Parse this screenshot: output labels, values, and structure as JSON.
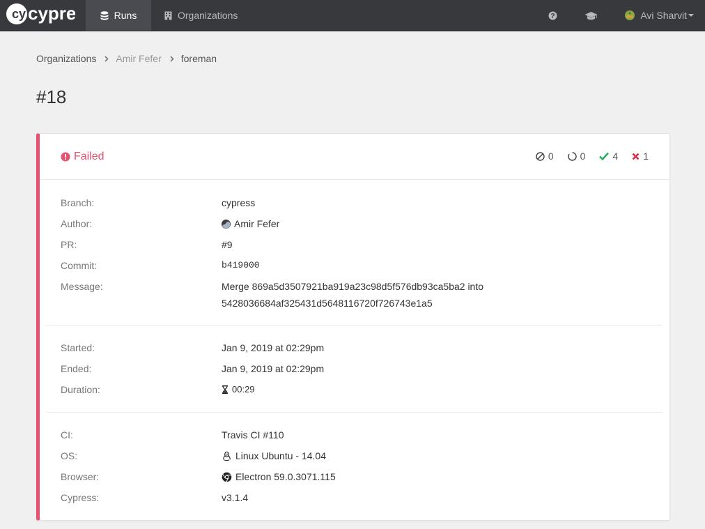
{
  "nav": {
    "logo_text": "cypress",
    "tabs": [
      {
        "label": "Runs",
        "active": true
      },
      {
        "label": "Organizations",
        "active": false
      }
    ],
    "user_name": "Avi Sharvit"
  },
  "breadcrumb": [
    "Organizations",
    "Amir Fefer",
    "foreman"
  ],
  "page_title": "#18",
  "run": {
    "status": "Failed",
    "counts": {
      "skipped": "0",
      "pending": "0",
      "passed": "4",
      "failed": "1"
    },
    "details": {
      "branch": {
        "label": "Branch:",
        "value": "cypress"
      },
      "author": {
        "label": "Author:",
        "value": "Amir Fefer"
      },
      "pr": {
        "label": "PR:",
        "value": "#9"
      },
      "commit": {
        "label": "Commit:",
        "value": "b419000"
      },
      "message": {
        "label": "Message:",
        "line1": "Merge 869a5d3507921ba919a23c98d5f576db93ca5ba2 into",
        "line2": "5428036684af325431d5648116720f726743e1a5"
      }
    },
    "timing": {
      "started": {
        "label": "Started:",
        "value": "Jan 9, 2019 at 02:29pm"
      },
      "ended": {
        "label": "Ended:",
        "value": "Jan 9, 2019 at 02:29pm"
      },
      "duration": {
        "label": "Duration:",
        "value": "00:29"
      }
    },
    "env": {
      "ci": {
        "label": "CI:",
        "value": "Travis CI #110"
      },
      "os": {
        "label": "OS:",
        "value": "Linux Ubuntu - 14.04"
      },
      "browser": {
        "label": "Browser:",
        "value": "Electron 59.0.3071.115"
      },
      "cypress": {
        "label": "Cypress:",
        "value": "v3.1.4"
      }
    }
  },
  "colors": {
    "accent_failed": "#e94f6f",
    "passed": "#27ae60",
    "failed": "#e0294a",
    "link": "#3a6ec9",
    "nav_bg": "#38393d"
  }
}
